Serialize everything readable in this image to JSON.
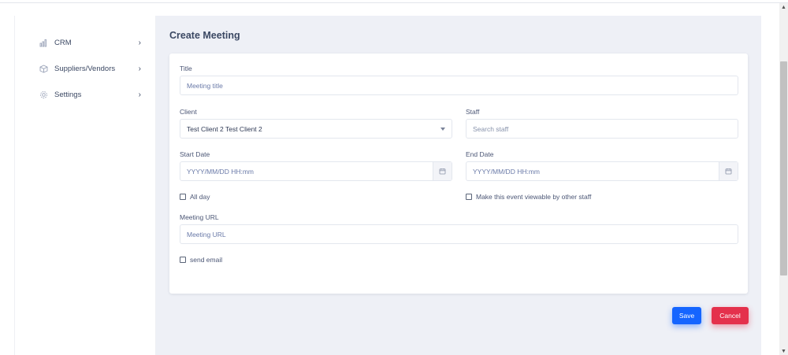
{
  "sidebar": {
    "items": [
      {
        "label": "CRM",
        "icon": "bar-chart-icon"
      },
      {
        "label": "Suppliers/Vendors",
        "icon": "box-icon"
      },
      {
        "label": "Settings",
        "icon": "gear-icon"
      }
    ],
    "chevron": "›"
  },
  "page": {
    "title": "Create Meeting"
  },
  "form": {
    "title": {
      "label": "Title",
      "placeholder": "Meeting title"
    },
    "client": {
      "label": "Client",
      "value": "Test Client 2 Test Client 2"
    },
    "staff": {
      "label": "Staff",
      "placeholder": "Search staff"
    },
    "start_date": {
      "label": "Start Date",
      "placeholder": "YYYY/MM/DD HH:mm"
    },
    "end_date": {
      "label": "End Date",
      "placeholder": "YYYY/MM/DD HH:mm"
    },
    "all_day": {
      "label": "All day",
      "checked": false
    },
    "viewable": {
      "label": "Make this event viewable by other staff",
      "checked": false
    },
    "meeting_url": {
      "label": "Meeting URL",
      "placeholder": "Meeting URL"
    },
    "send_email": {
      "label": "send email",
      "checked": false
    }
  },
  "actions": {
    "save_label": "Save",
    "cancel_label": "Cancel"
  },
  "colors": {
    "primary": "#1565ff",
    "danger": "#e4314c",
    "background": "#eef0f6",
    "text": "#3b4863"
  }
}
